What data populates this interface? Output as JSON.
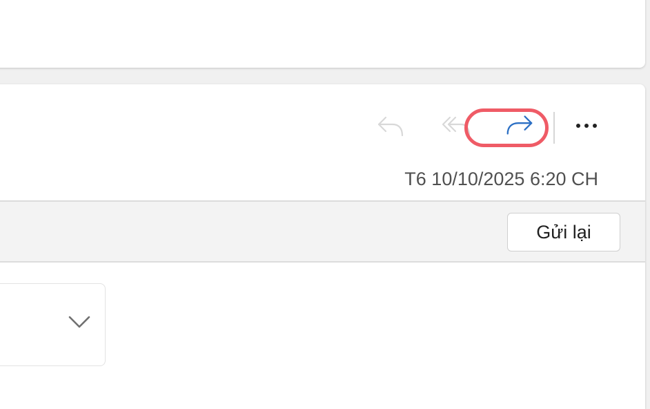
{
  "header": {
    "timestamp": "T6 10/10/2025 6:20 CH"
  },
  "toolbar": {
    "reply_icon": "reply-icon",
    "reply_all_icon": "reply-all-icon",
    "forward_icon": "forward-icon",
    "more_icon": "more-options-icon",
    "highlight_color": "#ef5b66",
    "forward_color": "#2b6fc4"
  },
  "resend": {
    "label": "Gửi lại"
  },
  "attachment": {
    "expand_icon": "chevron-down-icon"
  }
}
